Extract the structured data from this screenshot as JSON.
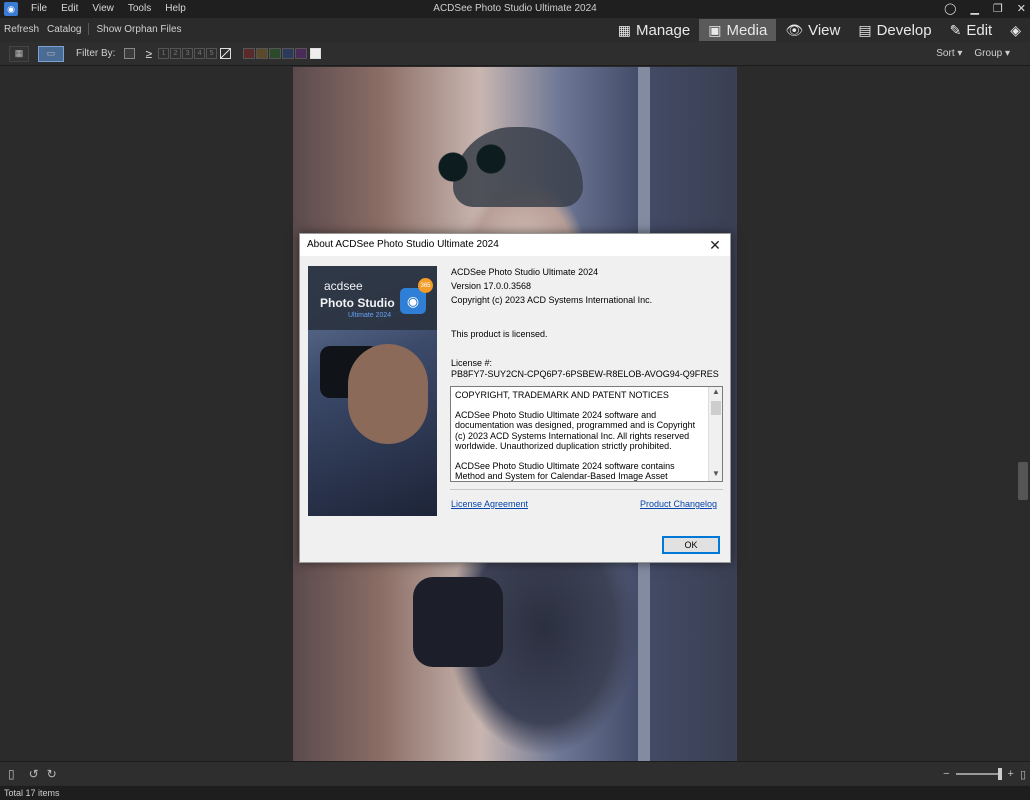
{
  "window": {
    "title": "ACDSee Photo Studio Ultimate 2024",
    "menu": [
      "File",
      "Edit",
      "View",
      "Tools",
      "Help"
    ],
    "controls": [
      "profile-icon",
      "minimize",
      "restore",
      "close"
    ]
  },
  "subbar": {
    "items": [
      "Refresh",
      "Catalog",
      "Show Orphan Files"
    ]
  },
  "modes": [
    {
      "label": "Manage",
      "icon": "grid-icon",
      "active": false
    },
    {
      "label": "Media",
      "icon": "media-icon",
      "active": true
    },
    {
      "label": "View",
      "icon": "eye-icon",
      "active": false
    },
    {
      "label": "Develop",
      "icon": "develop-icon",
      "active": false
    },
    {
      "label": "Edit",
      "icon": "edit-icon",
      "active": false
    }
  ],
  "filterbar": {
    "label": "Filter By:",
    "ge": "≥",
    "ratings": [
      "1",
      "2",
      "3",
      "4",
      "5"
    ],
    "sort": "Sort ▾",
    "group": "Group ▾",
    "color_labels": [
      "#5a2a2a",
      "#5a4a2a",
      "#2a4a2a",
      "#2a3a5a",
      "#4a2a5a"
    ]
  },
  "dialog": {
    "title": "About ACDSee Photo Studio Ultimate 2024",
    "product": "ACDSee Photo Studio Ultimate 2024",
    "version": "Version 17.0.0.3568",
    "copyright": "Copyright (c) 2023 ACD Systems International Inc.",
    "licensed": "This product is licensed.",
    "license_label": "License #:",
    "license_key": "PB8FY7-SUY2CN-CPQ6P7-6PSBEW-R8ELOB-AVOG94-Q9FRES",
    "notices_heading": "COPYRIGHT, TRADEMARK AND PATENT NOTICES",
    "notices_p1": "ACDSee Photo Studio Ultimate 2024 software and documentation was designed, programmed and is Copyright (c) 2023 ACD Systems International Inc. All rights reserved worldwide. Unauthorized duplication strictly prohibited.",
    "notices_p2": "ACDSee Photo Studio Ultimate 2024 software contains Method and System for Calendar-Based Image Asset Organization.",
    "link_license": "License Agreement",
    "link_changelog": "Product Changelog",
    "ok": "OK",
    "splash": {
      "brand": "acdsee",
      "name": "Photo Studio",
      "edition": "Ultimate 2024"
    }
  },
  "status": {
    "total": "Total 17 items"
  }
}
